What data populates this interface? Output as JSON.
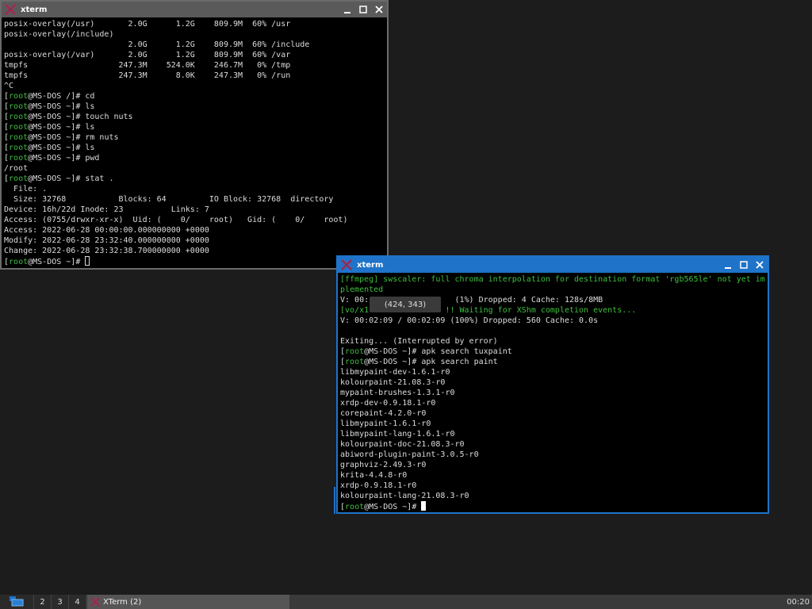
{
  "windows": [
    {
      "title": "xterm",
      "lines": [
        {
          "text": "posix-overlay(/usr)       2.0G      1.2G    809.9M  60% /usr"
        },
        {
          "text": "posix-overlay(/include)"
        },
        {
          "text": "                          2.0G      1.2G    809.9M  60% /include"
        },
        {
          "text": "posix-overlay(/var)       2.0G      1.2G    809.9M  60% /var"
        },
        {
          "text": "tmpfs                   247.3M    524.0K    246.7M   0% /tmp"
        },
        {
          "text": "tmpfs                   247.3M      8.0K    247.3M   0% /run"
        },
        {
          "text": "^C"
        },
        {
          "prompt": "[root@MS-DOS /]# ",
          "text": "cd"
        },
        {
          "prompt": "[root@MS-DOS ~]# ",
          "text": "ls"
        },
        {
          "prompt": "[root@MS-DOS ~]# ",
          "text": "touch nuts"
        },
        {
          "prompt": "[root@MS-DOS ~]# ",
          "text": "ls"
        },
        {
          "prompt": "[root@MS-DOS ~]# ",
          "text": "rm nuts"
        },
        {
          "prompt": "[root@MS-DOS ~]# ",
          "text": "ls"
        },
        {
          "prompt": "[root@MS-DOS ~]# ",
          "text": "pwd"
        },
        {
          "text": "/root"
        },
        {
          "prompt": "[root@MS-DOS ~]# ",
          "text": "stat ."
        },
        {
          "text": "  File: ."
        },
        {
          "text": "  Size: 32768           Blocks: 64         IO Block: 32768  directory"
        },
        {
          "text": "Device: 16h/22d Inode: 23          Links: 7"
        },
        {
          "text": "Access: (0755/drwxr-xr-x)  Uid: (    0/    root)   Gid: (    0/    root)"
        },
        {
          "text": "Access: 2022-06-28 00:00:00.000000000 +0000"
        },
        {
          "text": "Modify: 2022-06-28 23:32:40.000000000 +0000"
        },
        {
          "text": "Change: 2022-06-28 23:32:38.700000000 +0000"
        },
        {
          "prompt": "[root@MS-DOS ~]# ",
          "text": "",
          "cursor": true
        }
      ]
    },
    {
      "title": "xterm",
      "lines": [
        {
          "text": "[ffmpeg] swscaler: full chroma interpolation for destination format 'rgb565le' not yet im",
          "color": "green"
        },
        {
          "text": "plemented",
          "color": "green"
        },
        {
          "text": "V: 00:                  (1%) Dropped: 4 Cache: 128s/8MB"
        },
        {
          "text": "[vo/x1                !! Waiting for XShm completion events...",
          "color": "green"
        },
        {
          "text": "V: 00:02:09 / 00:02:09 (100%) Dropped: 560 Cache: 0.0s"
        },
        {
          "text": ""
        },
        {
          "text": "Exiting... (Interrupted by error)"
        },
        {
          "prompt": "[root@MS-DOS ~]# ",
          "text": "apk search tuxpaint"
        },
        {
          "prompt": "[root@MS-DOS ~]# ",
          "text": "apk search paint"
        },
        {
          "text": "libmypaint-dev-1.6.1-r0"
        },
        {
          "text": "kolourpaint-21.08.3-r0"
        },
        {
          "text": "mypaint-brushes-1.3.1-r0"
        },
        {
          "text": "xrdp-dev-0.9.18.1-r0"
        },
        {
          "text": "corepaint-4.2.0-r0"
        },
        {
          "text": "libmypaint-1.6.1-r0"
        },
        {
          "text": "libmypaint-lang-1.6.1-r0"
        },
        {
          "text": "kolourpaint-doc-21.08.3-r0"
        },
        {
          "text": "abiword-plugin-paint-3.0.5-r0"
        },
        {
          "text": "graphviz-2.49.3-r0"
        },
        {
          "text": "krita-4.4.8-r0"
        },
        {
          "text": "xrdp-0.9.18.1-r0"
        },
        {
          "text": "kolourpaint-lang-21.08.3-r0"
        },
        {
          "prompt": "[root@MS-DOS ~]# ",
          "text": "",
          "cursor": true
        }
      ]
    }
  ],
  "tooltip": "(424, 343)",
  "taskbar": {
    "workspaces": [
      "2",
      "3",
      "4"
    ],
    "task_label": "XTerm (2)",
    "clock": "00:20"
  },
  "colors": {
    "active_border": "#1f73c9",
    "inactive_border": "#6b6b6b",
    "prompt_green": "#3fbf3f"
  }
}
